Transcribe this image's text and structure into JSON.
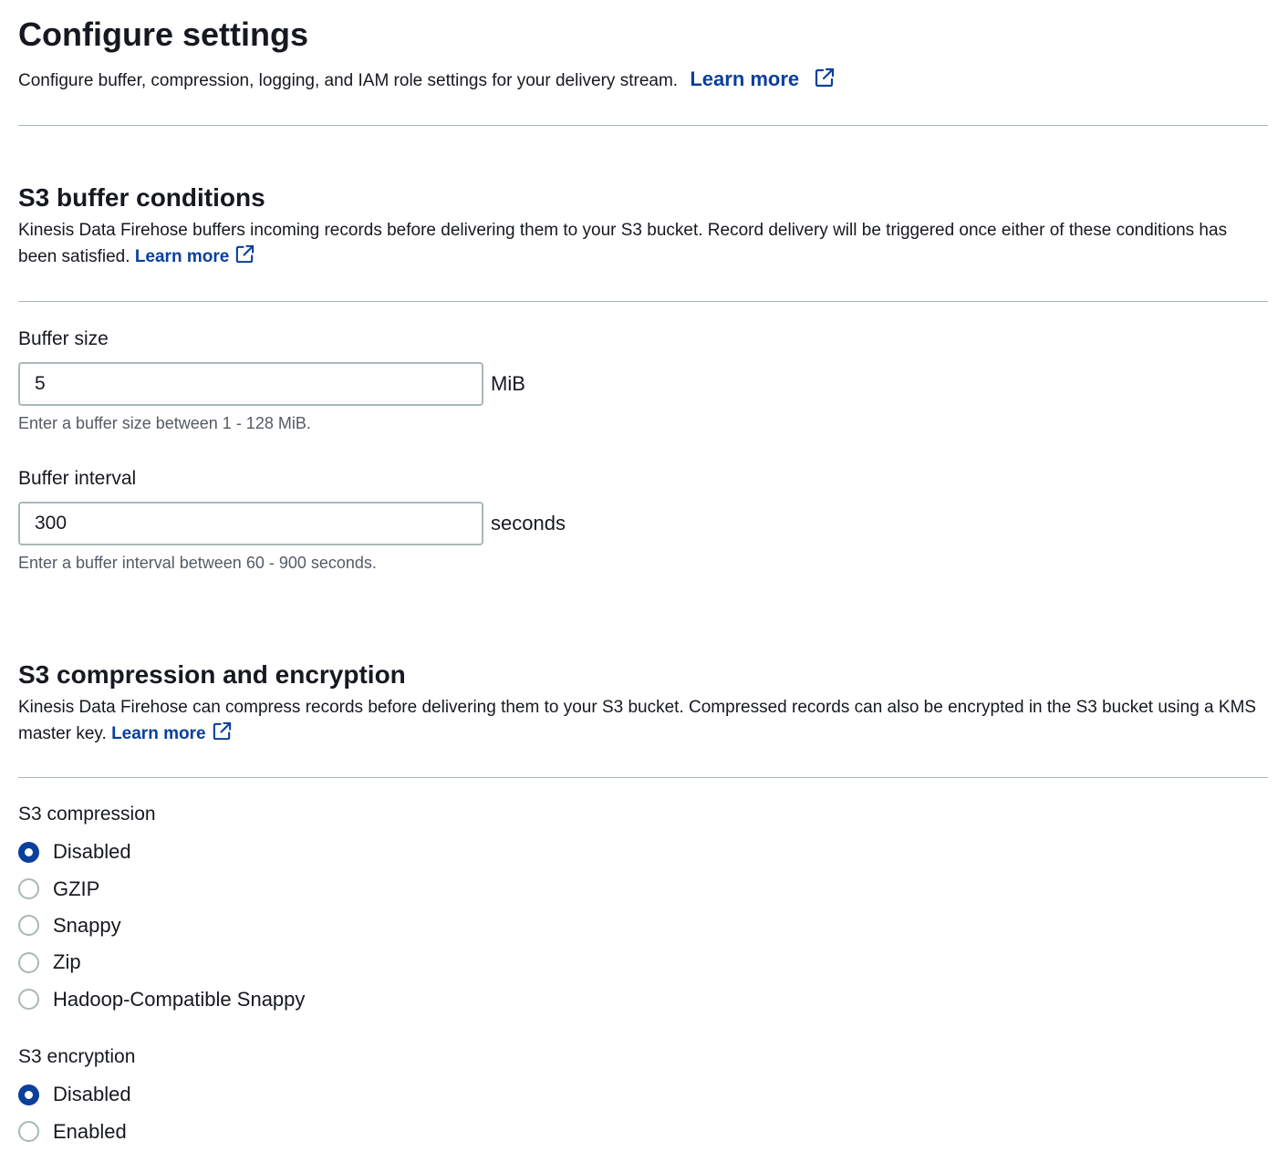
{
  "header": {
    "title": "Configure settings",
    "description": "Configure buffer, compression, logging, and IAM role settings for your delivery stream.",
    "learn_more": "Learn more"
  },
  "buffer_section": {
    "title": "S3 buffer conditions",
    "description": "Kinesis Data Firehose buffers incoming records before delivering them to your S3 bucket. Record delivery will be triggered once either of these conditions has been satisfied.",
    "learn_more": "Learn more",
    "buffer_size": {
      "label": "Buffer size",
      "value": "5",
      "unit": "MiB",
      "hint": "Enter a buffer size between 1 - 128 MiB."
    },
    "buffer_interval": {
      "label": "Buffer interval",
      "value": "300",
      "unit": "seconds",
      "hint": "Enter a buffer interval between 60 - 900 seconds."
    }
  },
  "compression_section": {
    "title": "S3 compression and encryption",
    "description": "Kinesis Data Firehose can compress records before delivering them to your S3 bucket. Compressed records can also be encrypted in the S3 bucket using a KMS master key.",
    "learn_more": "Learn more",
    "compression": {
      "label": "S3 compression",
      "options": [
        "Disabled",
        "GZIP",
        "Snappy",
        "Zip",
        "Hadoop-Compatible Snappy"
      ],
      "selected": "Disabled"
    },
    "encryption": {
      "label": "S3 encryption",
      "options": [
        "Disabled",
        "Enabled"
      ],
      "selected": "Disabled"
    }
  },
  "colors": {
    "link": "#0a3f9c",
    "radio_selected": "#0a3f9c",
    "divider": "#aab7b8",
    "text": "#16191f",
    "hint": "#545b64"
  },
  "icons": {
    "external_link": "external-link-icon"
  }
}
